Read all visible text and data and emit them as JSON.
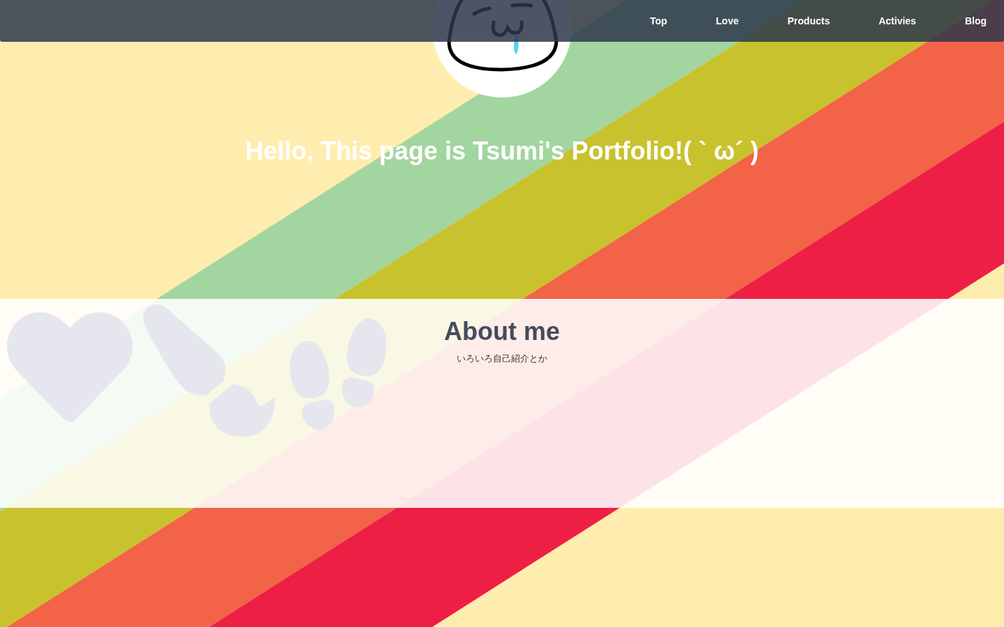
{
  "nav": {
    "items": [
      {
        "label": "Top"
      },
      {
        "label": "Love"
      },
      {
        "label": "Products"
      },
      {
        "label": "Activies"
      },
      {
        "label": "Blog"
      }
    ]
  },
  "hero": {
    "title": "Hello, This page is Tsumi's Portfolio!( ` ω´ )"
  },
  "about": {
    "title": "About me",
    "subtitle": "いろいろ自己紹介とか"
  }
}
